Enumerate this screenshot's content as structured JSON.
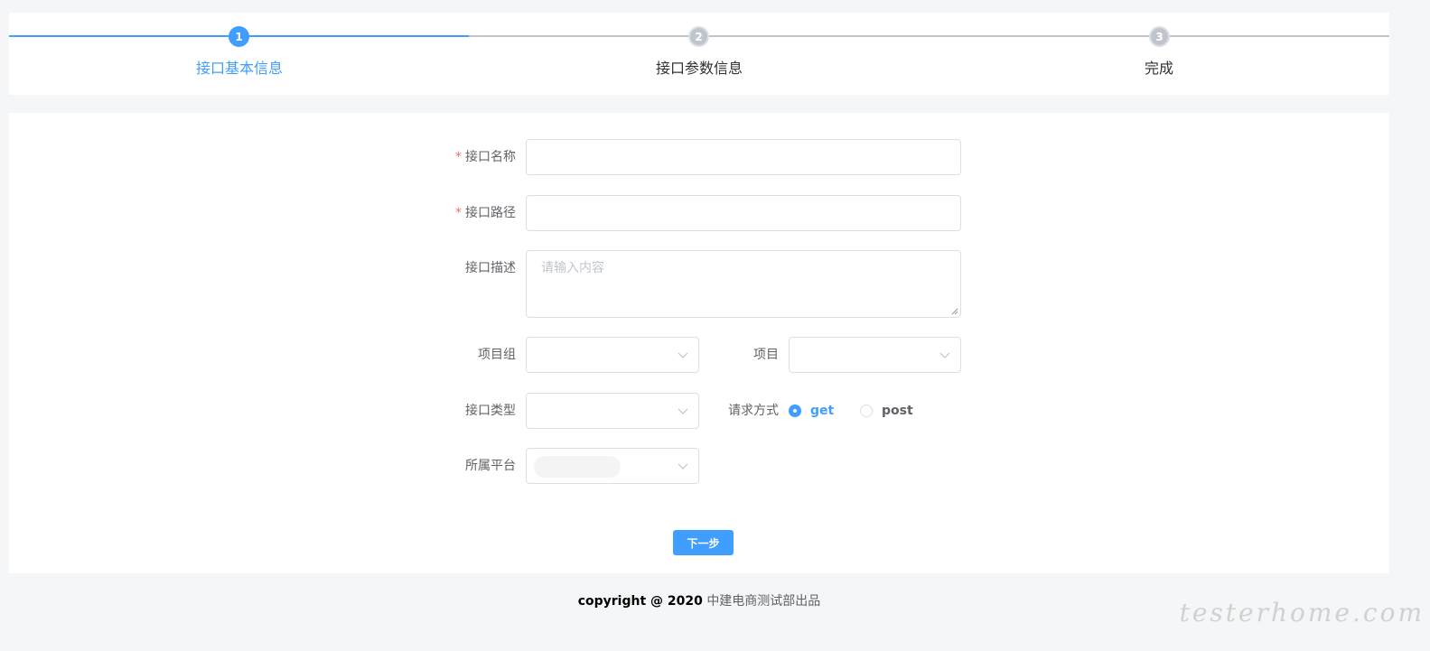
{
  "steps": [
    {
      "number": "1",
      "title": "接口基本信息",
      "state": "active"
    },
    {
      "number": "2",
      "title": "接口参数信息",
      "state": "inactive"
    },
    {
      "number": "3",
      "title": "完成",
      "state": "inactive"
    }
  ],
  "form": {
    "name_label": "接口名称",
    "name_value": "",
    "path_label": "接口路径",
    "path_value": "",
    "desc_label": "接口描述",
    "desc_placeholder": "请输入内容",
    "group_label": "项目组",
    "project_label": "项目",
    "type_label": "接口类型",
    "method_label": "请求方式",
    "method_options": [
      "get",
      "post"
    ],
    "method_selected": "get",
    "platform_label": "所属平台",
    "required_star": "*"
  },
  "next_button_label": "下一步",
  "footer": {
    "copyright": "copyright @ 2020",
    "dept": "中建电商测试部出品"
  },
  "watermark": "testerhome.com",
  "colors": {
    "primary": "#409eff",
    "border": "#dcdfe6",
    "required": "#f56c6c"
  }
}
